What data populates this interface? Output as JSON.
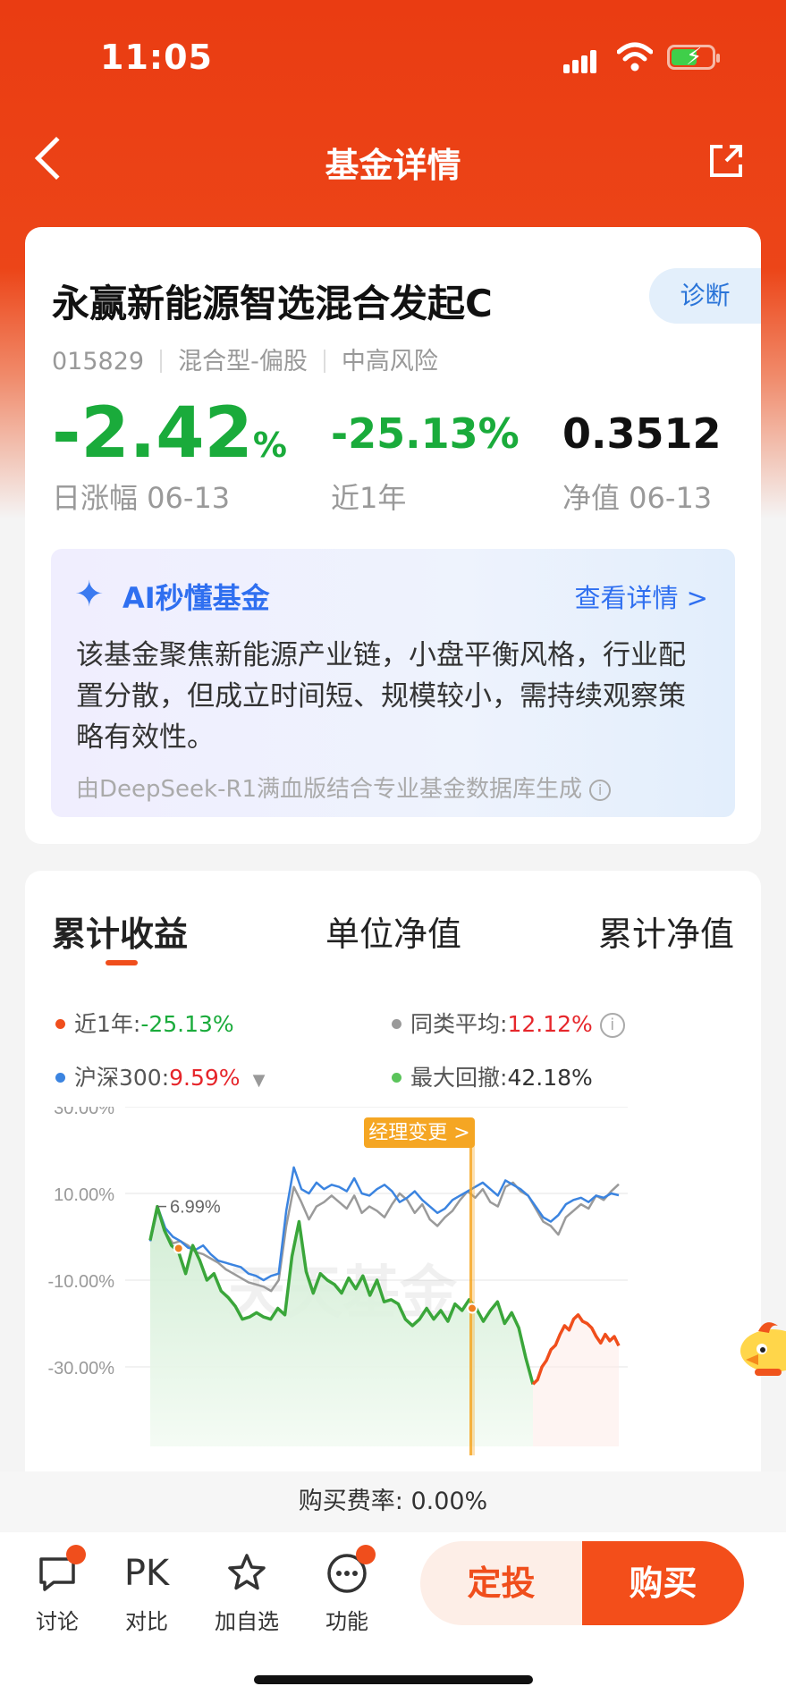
{
  "status_bar": {
    "time": "11:05"
  },
  "nav": {
    "title": "基金详情"
  },
  "fund": {
    "name": "永赢新能源智选混合发起C",
    "diagnose_label": "诊断",
    "code": "015829",
    "type": "混合型-偏股",
    "risk": "中高风险",
    "daily_change_value": "-2.42",
    "daily_change_unit": "%",
    "daily_change_label": "日涨幅 06-13",
    "year_change_value": "-25.13%",
    "year_change_label": "近1年",
    "nav_value": "0.3512",
    "nav_label": "净值 06-13"
  },
  "ai": {
    "title": "AI秒懂基金",
    "more": "查看详情 >",
    "body": "该基金聚焦新能源产业链，小盘平衡风格，行业配置分散，但成立时间短、规模较小，需持续观察策略有效性。",
    "source": "由DeepSeek-R1满血版结合专业基金数据库生成"
  },
  "tabs": [
    "累计收益",
    "单位净值",
    "累计净值"
  ],
  "legend": {
    "year_label": "近1年:",
    "year_value": "-25.13%",
    "peer_label": "同类平均:",
    "peer_value": "12.12%",
    "hs300_label": "沪深300:",
    "hs300_value": "9.59%",
    "drawdown_label": "最大回撤:",
    "drawdown_value": "42.18%"
  },
  "chart_data": {
    "type": "line",
    "y_ticks": [
      "30.00%",
      "10.00%",
      "-10.00%",
      "-30.00%"
    ],
    "ylim": [
      -34,
      30
    ],
    "annotation_peak": "6.99%",
    "annotation_manager": "经理变更 >",
    "watermark": "天天基金",
    "colors": {
      "fund": "#3aa63a",
      "fund_after": "#f04e1c",
      "peer": "#9a9a9a",
      "hs300": "#3b84e0"
    },
    "series": [
      {
        "key": "fund",
        "values": [
          -0.8,
          6.99,
          1.5,
          -2.0,
          -3.5,
          -8.5,
          -2.0,
          -5.5,
          -10.0,
          -8.5,
          -12.5,
          -14.0,
          -16.0,
          -19.0,
          -18.5,
          -17.5,
          -18.5,
          -19.0,
          -16.5,
          -18.0,
          -4.5,
          3.5,
          -8.0,
          -13.0,
          -8.5,
          -10.0,
          -11.0,
          -13.0,
          -9.5,
          -12.0,
          -9.0,
          -13.5,
          -10.0,
          -15.0,
          -14.5,
          -15.5,
          -19.0,
          -20.5,
          -19.0,
          -16.5,
          -19.0,
          -17.0,
          -19.5,
          -15.5,
          -17.0,
          -14.5,
          -16.5,
          -19.5,
          -17.0,
          -15.0,
          -20.0,
          -17.5,
          -21.0,
          -28.0,
          -34.0
        ]
      },
      {
        "key": "fund_after",
        "values": [
          -34.0,
          -33.0,
          -30.0,
          -28.5,
          -26.0,
          -25.0,
          -22.5,
          -20.5,
          -21.5,
          -19.0,
          -18.0,
          -19.5,
          -20.0,
          -21.0,
          -23.0,
          -24.5,
          -22.5,
          -24.0,
          -23.0,
          -25.13
        ]
      },
      {
        "key": "peer",
        "values": [
          -1.0,
          6.5,
          1.0,
          -1.5,
          -1.0,
          -2.0,
          -3.5,
          -4.0,
          -5.0,
          -6.0,
          -7.5,
          -8.5,
          -9.5,
          -10.5,
          -11.0,
          -11.5,
          -12.5,
          -10.0,
          2.5,
          11.5,
          8.0,
          4.0,
          7.0,
          8.0,
          9.5,
          8.0,
          6.5,
          9.5,
          5.5,
          7.0,
          6.0,
          4.5,
          7.5,
          10.0,
          8.5,
          5.5,
          7.5,
          4.0,
          2.5,
          4.5,
          6.0,
          8.5,
          10.5,
          9.0,
          11.0,
          8.0,
          7.0,
          11.5,
          12.5,
          10.5,
          9.5,
          6.5,
          3.5,
          2.5,
          0.5,
          4.5,
          6.0,
          7.5,
          6.5,
          9.5,
          8.5,
          10.5,
          12.12
        ]
      },
      {
        "key": "hs300",
        "values": [
          -1.0,
          6.8,
          2.0,
          0.0,
          -1.0,
          -2.5,
          -3.0,
          -2.0,
          -4.0,
          -5.5,
          -6.0,
          -6.5,
          -7.0,
          -8.5,
          -9.0,
          -10.0,
          -9.0,
          -8.5,
          6.0,
          16.0,
          11.0,
          10.0,
          12.5,
          11.0,
          12.0,
          11.5,
          10.5,
          13.5,
          10.0,
          9.5,
          11.0,
          12.0,
          10.5,
          8.0,
          9.0,
          10.5,
          8.5,
          7.0,
          5.5,
          6.5,
          8.5,
          9.5,
          10.5,
          11.5,
          12.5,
          11.0,
          9.5,
          13.0,
          12.0,
          11.0,
          9.5,
          7.0,
          4.5,
          3.5,
          5.0,
          7.5,
          8.5,
          9.0,
          8.0,
          9.5,
          9.0,
          10.0,
          9.59
        ]
      }
    ]
  },
  "bottom": {
    "fee_text": "购买费率: 0.00%",
    "actions": [
      "讨论",
      "对比",
      "加自选",
      "功能"
    ],
    "pk_text": "PK",
    "btn_sip": "定投",
    "btn_buy": "购买"
  }
}
